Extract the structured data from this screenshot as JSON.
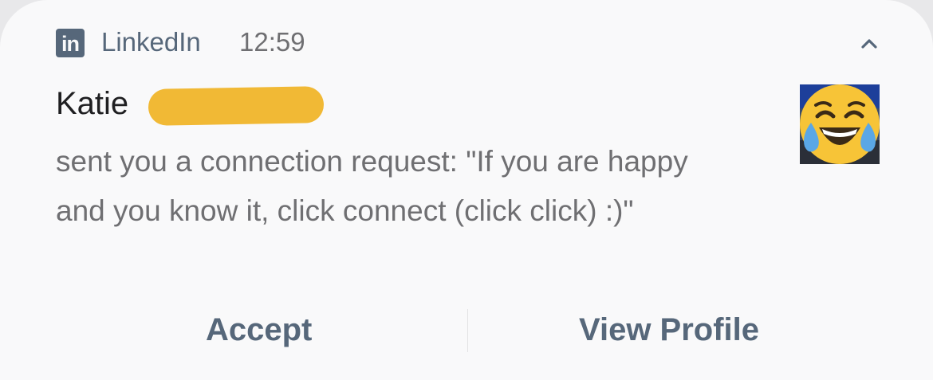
{
  "notification": {
    "app_icon": "linkedin-icon",
    "app_icon_text": "in",
    "app_name": "LinkedIn",
    "time": "12:59",
    "collapse_icon": "chevron-up-icon",
    "sender_name": "Katie",
    "message": "sent you a connection request: \"If you are happy and you know it, click connect (click click) :)\"",
    "avatar_icon": "face-with-tears-of-joy-emoji"
  },
  "actions": {
    "accept_label": "Accept",
    "view_profile_label": "View Profile"
  },
  "colors": {
    "accent": "#56677a",
    "redaction": "#f1b935",
    "background": "#f9f9fa"
  }
}
